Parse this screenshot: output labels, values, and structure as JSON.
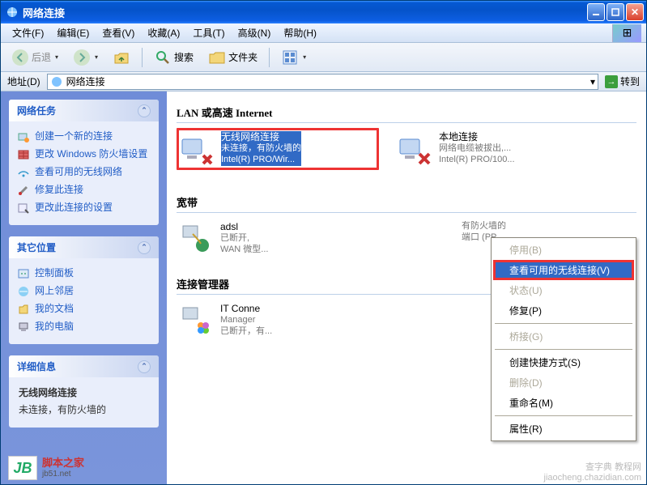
{
  "window": {
    "title": "网络连接"
  },
  "menu": {
    "file": "文件(F)",
    "edit": "编辑(E)",
    "view": "查看(V)",
    "favorites": "收藏(A)",
    "tools": "工具(T)",
    "advanced": "高级(N)",
    "help": "帮助(H)"
  },
  "toolbar": {
    "back": "后退",
    "search": "搜索",
    "folders": "文件夹"
  },
  "address": {
    "label": "地址(D)",
    "value": "网络连接",
    "go": "转到"
  },
  "sidebar": {
    "tasks_header": "网络任务",
    "tasks": [
      "创建一个新的连接",
      "更改 Windows 防火墙设置",
      "查看可用的无线网络",
      "修复此连接",
      "更改此连接的设置"
    ],
    "places_header": "其它位置",
    "places": [
      "控制面板",
      "网上邻居",
      "我的文档",
      "我的电脑"
    ],
    "detail_header": "详细信息",
    "detail": {
      "title": "无线网络连接",
      "sub": "未连接，有防火墙的"
    }
  },
  "content": {
    "sections": {
      "lan": "LAN 或高速 Internet",
      "broadband": "宽带",
      "connmgr": "连接管理器"
    },
    "lan_items": [
      {
        "title": "无线网络连接",
        "sub1": "未连接，有防火墙的",
        "sub2": "Intel(R) PRO/Wir...",
        "selected": true
      },
      {
        "title": "本地连接",
        "sub1": "网络电缆被拔出,...",
        "sub2": "Intel(R) PRO/100..."
      }
    ],
    "broadband_items": [
      {
        "title": "adsl",
        "sub1": "已断开,",
        "sub2": "WAN 微型..."
      },
      {
        "title_partial": "有防火墙的",
        "sub_partial": "端口 (PP..."
      }
    ],
    "connmgr_items": [
      {
        "title": "IT Conne",
        "sub1": "Manager",
        "sub2": "已断开，有..."
      }
    ]
  },
  "contextmenu": [
    {
      "label": "停用(B)",
      "disabled": true
    },
    {
      "label": "查看可用的无线连接(V)",
      "highlighted": true
    },
    {
      "label": "状态(U)",
      "disabled": true
    },
    {
      "label": "修复(P)"
    },
    {
      "sep": true
    },
    {
      "label": "桥接(G)",
      "disabled": true
    },
    {
      "sep": true
    },
    {
      "label": "创建快捷方式(S)"
    },
    {
      "label": "删除(D)",
      "disabled": true
    },
    {
      "label": "重命名(M)"
    },
    {
      "sep": true
    },
    {
      "label": "属性(R)"
    }
  ],
  "watermark": {
    "line1": "查字典  教程网",
    "line2": "jiaocheng.chazidian.com"
  },
  "footer_logo": {
    "text": "脚本之家",
    "sub": "jb51.net"
  }
}
